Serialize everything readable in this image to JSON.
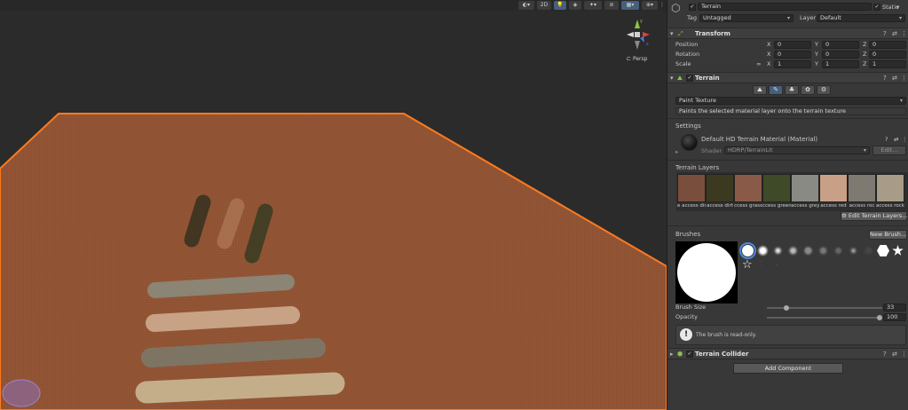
{
  "scene": {
    "toolbar": {
      "mode_2d_label": "2D"
    },
    "gizmo_label": "Persp"
  },
  "inspector": {
    "object": {
      "name": "Terrain",
      "static_label": "Static",
      "tag_label": "Tag",
      "tag_value": "Untagged",
      "layer_label": "Layer",
      "layer_value": "Default"
    },
    "transform": {
      "title": "Transform",
      "rows": [
        {
          "label": "Position",
          "x": "0",
          "y": "0",
          "z": "0"
        },
        {
          "label": "Rotation",
          "x": "0",
          "y": "0",
          "z": "0"
        },
        {
          "label": "Scale",
          "x": "1",
          "y": "1",
          "z": "1"
        }
      ],
      "axis_x": "X",
      "axis_y": "Y",
      "axis_z": "Z"
    },
    "terrain": {
      "title": "Terrain",
      "mode_value": "Paint Texture",
      "mode_description": "Paints the selected material layer onto the terrain texture",
      "settings_label": "Settings",
      "material_name": "Default HD Terrain Material (Material)",
      "shader_label": "Shader",
      "shader_value": "HDRP/TerrainLit",
      "edit_label": "Edit...",
      "layers_label": "Terrain Layers",
      "layers": [
        {
          "label": "e access dir",
          "color": "#7a4e3c"
        },
        {
          "label": "access dirt",
          "color": "#3b3a20"
        },
        {
          "label": "ccess grass",
          "color": "#8a5a48"
        },
        {
          "label": "ccess green",
          "color": "#3f4a28"
        },
        {
          "label": "access grey",
          "color": "#8a8a84"
        },
        {
          "label": "access red",
          "color": "#c8a088"
        },
        {
          "label": "access roc",
          "color": "#7e7a72"
        },
        {
          "label": "access rock",
          "color": "#a89c88"
        }
      ],
      "edit_layers_label": "Edit Terrain Layers...",
      "brushes_label": "Brushes",
      "new_brush_label": "New Brush...",
      "brush_size_label": "Brush Size",
      "brush_size_value": "33",
      "brush_size_fraction": 0.04,
      "opacity_label": "Opacity",
      "opacity_value": "100",
      "opacity_fraction": 1.0,
      "readonly_note": "The brush is read-only."
    },
    "collider": {
      "title": "Terrain Collider"
    },
    "add_component_label": "Add Component"
  },
  "colors": {
    "selection_outline": "#ff7a1e",
    "terrain_fill": "#8f5334",
    "accent": "#46607c"
  }
}
